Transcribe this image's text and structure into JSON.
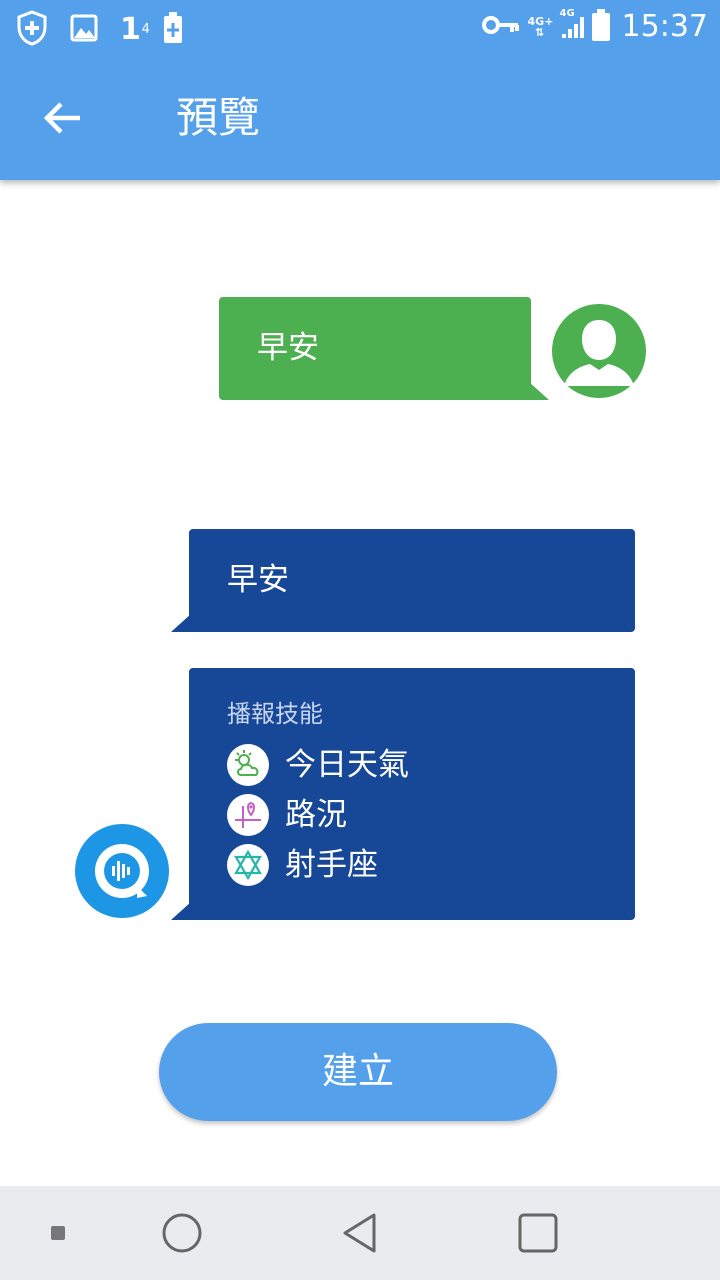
{
  "status_bar": {
    "one_label": "1",
    "one_superscript": "4",
    "net_type_1": "4G+",
    "net_type_2": "4G",
    "time": "15:37"
  },
  "toolbar": {
    "title": "預覽"
  },
  "chat": {
    "user_message": "早安",
    "bot_message": "早安",
    "skills_heading": "播報技能",
    "skills": [
      {
        "label": "今日天氣",
        "icon": "weather-icon"
      },
      {
        "label": "路況",
        "icon": "traffic-map-icon"
      },
      {
        "label": "射手座",
        "icon": "star-of-david-icon"
      }
    ]
  },
  "create_button": {
    "label": "建立"
  },
  "colors": {
    "app_bar": "#55a0eb",
    "user_bubble": "#4caf50",
    "bot_bubble": "#174797",
    "bot_avatar": "#1e96e6",
    "nav_bar": "#e9ebee"
  }
}
